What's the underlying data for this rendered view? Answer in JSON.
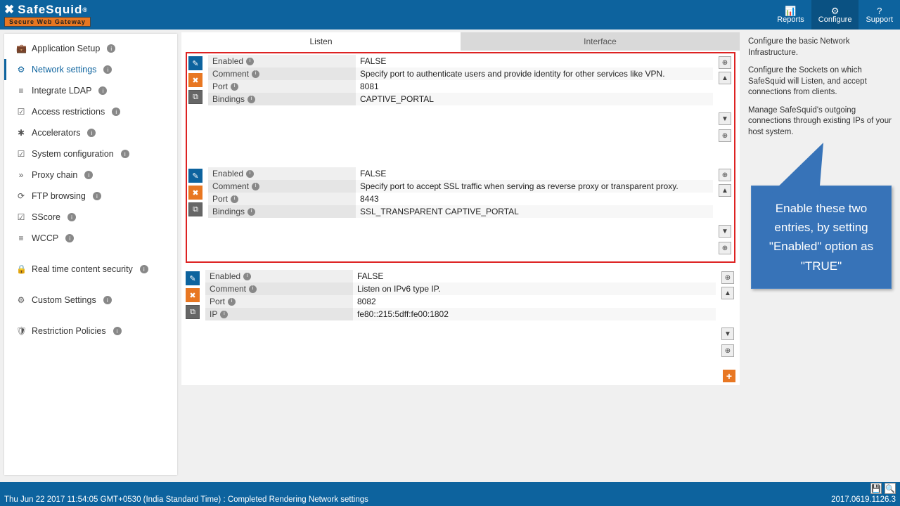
{
  "header": {
    "brand": "SafeSquid",
    "reg": "®",
    "tagline": "Secure Web Gateway",
    "actions": [
      {
        "icon": "📊",
        "label": "Reports"
      },
      {
        "icon": "⚙",
        "label": "Configure"
      },
      {
        "icon": "?",
        "label": "Support"
      }
    ]
  },
  "sidebar": {
    "items": [
      {
        "icon": "💼",
        "label": "Application Setup",
        "info": true
      },
      {
        "icon": "⚙",
        "label": "Network settings",
        "info": true,
        "active": true
      },
      {
        "icon": "≡",
        "label": "Integrate LDAP",
        "info": true
      },
      {
        "icon": "☑",
        "label": "Access restrictions",
        "info": true
      },
      {
        "icon": "✱",
        "label": "Accelerators",
        "info": true
      },
      {
        "icon": "☑",
        "label": "System configuration",
        "info": true
      },
      {
        "icon": "»",
        "label": "Proxy chain",
        "info": true
      },
      {
        "icon": "⟳",
        "label": "FTP browsing",
        "info": true
      },
      {
        "icon": "☑",
        "label": "SScore",
        "info": true
      },
      {
        "icon": "≡",
        "label": "WCCP",
        "info": true
      },
      {
        "spacer": true
      },
      {
        "icon": "🔒",
        "label": "Real time content security",
        "info": true
      },
      {
        "spacer": true
      },
      {
        "icon": "⚙",
        "label": "Custom Settings",
        "info": true
      },
      {
        "spacer": true
      },
      {
        "icon": "🛡",
        "label": "Restriction Policies",
        "info": true
      }
    ]
  },
  "tabs": [
    {
      "label": "Listen",
      "active": true
    },
    {
      "label": "Interface",
      "active": false
    }
  ],
  "entries": [
    {
      "highlighted": true,
      "rows": [
        {
          "label": "Enabled",
          "value": "FALSE"
        },
        {
          "label": "Comment",
          "value": "Specify port to authenticate users and provide identity for other services like VPN."
        },
        {
          "label": "Port",
          "value": "8081"
        },
        {
          "label": "Bindings",
          "value": "CAPTIVE_PORTAL"
        }
      ]
    },
    {
      "highlighted": true,
      "rows": [
        {
          "label": "Enabled",
          "value": "FALSE"
        },
        {
          "label": "Comment",
          "value": "Specify port to accept SSL traffic when serving as reverse proxy or transparent proxy."
        },
        {
          "label": "Port",
          "value": "8443"
        },
        {
          "label": "Bindings",
          "value": "SSL_TRANSPARENT   CAPTIVE_PORTAL"
        }
      ]
    },
    {
      "highlighted": false,
      "rows": [
        {
          "label": "Enabled",
          "value": "FALSE"
        },
        {
          "label": "Comment",
          "value": "Listen on IPv6 type IP."
        },
        {
          "label": "Port",
          "value": "8082"
        },
        {
          "label": "IP",
          "value": "fe80::215:5dff:fe00:1802"
        }
      ]
    }
  ],
  "rightHelp": [
    "Configure the basic Network Infrastructure.",
    "Configure the Sockets on which SafeSquid will Listen, and accept connections from clients.",
    "Manage SafeSquid's outgoing connections through existing IPs of your host system."
  ],
  "callout": "Enable these two entries, by setting \"Enabled\" option as \"TRUE\"",
  "footer": {
    "status": "Thu Jun 22 2017 11:54:05 GMT+0530 (India Standard Time) : Completed Rendering Network settings",
    "version": "2017.0619.1126.3"
  }
}
